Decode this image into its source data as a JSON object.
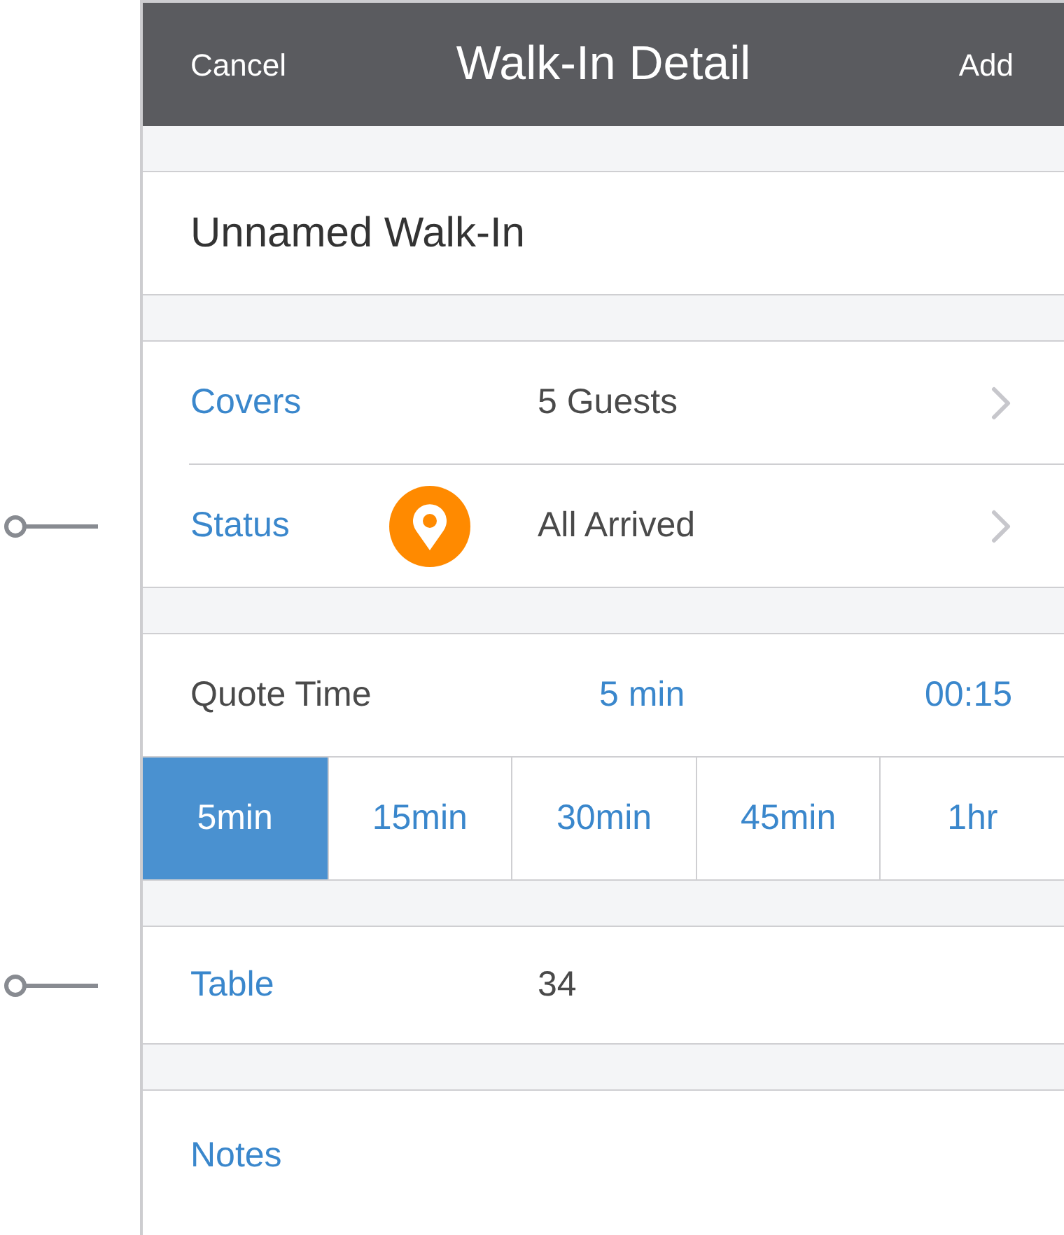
{
  "nav_bar": {
    "left_button": "Cancel",
    "title": "Walk-In Detail",
    "right_button": "Add"
  },
  "name_field": {
    "value": "Unnamed Walk-In"
  },
  "detail_rows": [
    {
      "kind": "covers",
      "label": "Covers",
      "value": "5 Guests",
      "callout": false
    },
    {
      "kind": "status",
      "label": "Status",
      "value": "All Arrived",
      "callout": true
    }
  ],
  "quote_time": {
    "label": "Quote Time",
    "selected_value": "5 min",
    "timer": "00:15",
    "options": [
      {
        "label": "5min",
        "selected": true
      },
      {
        "label": "15min",
        "selected": false
      },
      {
        "label": "30min",
        "selected": false
      },
      {
        "label": "45min",
        "selected": false
      },
      {
        "label": "1hr",
        "selected": false
      }
    ]
  },
  "table_row": {
    "label": "Table",
    "value": "34",
    "callout": true
  },
  "notes": {
    "label": "Notes"
  }
}
